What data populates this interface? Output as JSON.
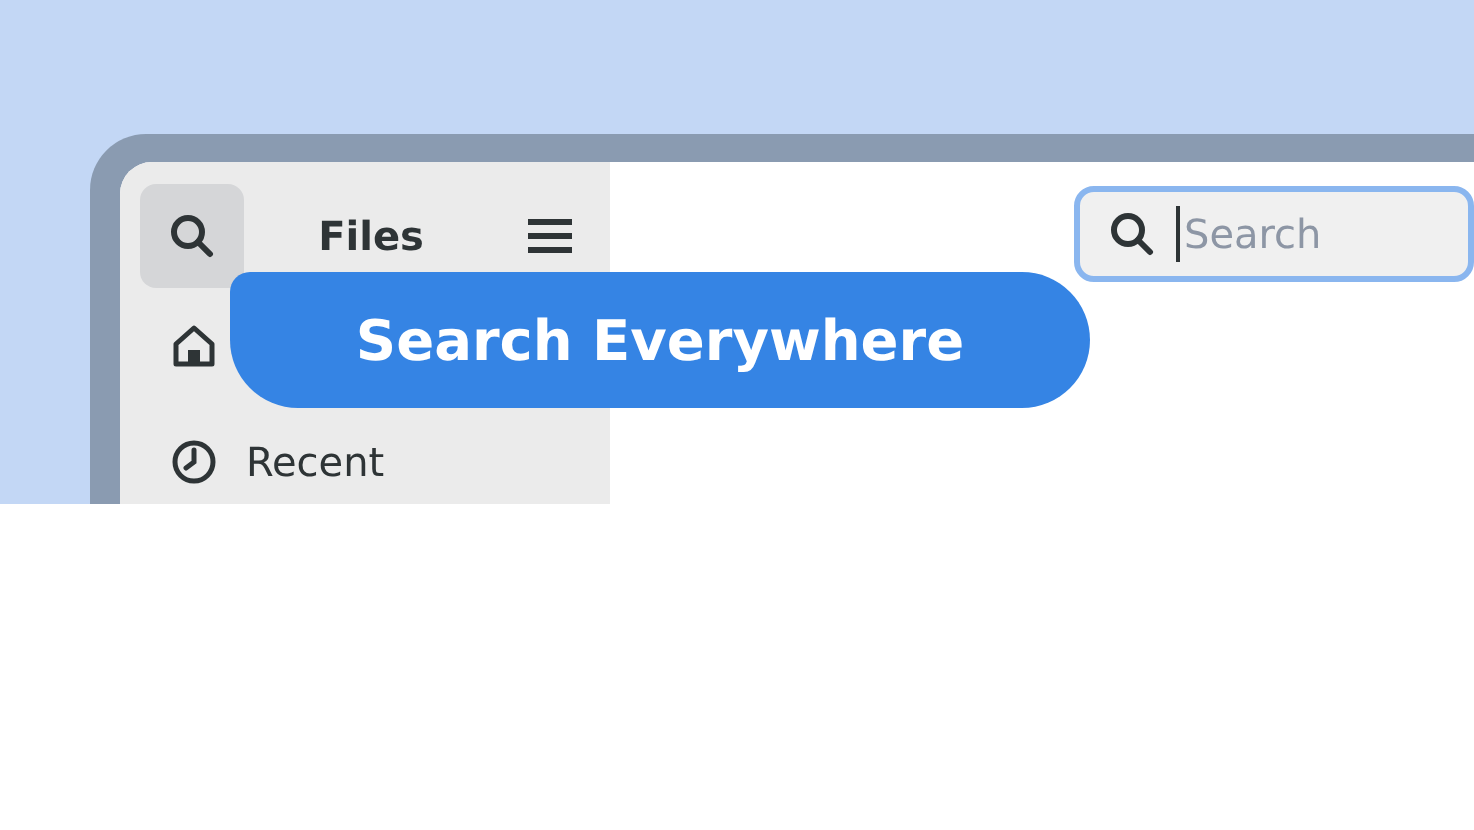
{
  "window": {
    "title": "Files"
  },
  "sidebar": {
    "items": [
      {
        "kind": "home"
      },
      {
        "kind": "recent",
        "label": "Recent"
      }
    ]
  },
  "search": {
    "placeholder": "Search",
    "focused": true
  },
  "banner": {
    "text": "Search Everywhere"
  }
}
